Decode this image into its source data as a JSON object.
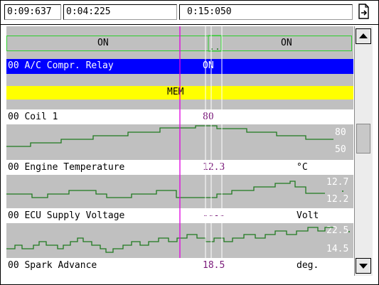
{
  "toolbar": {
    "time_start": "0:09:637",
    "time_mid": "0:04:225",
    "time_end": "0:15:050"
  },
  "channels": [
    {
      "name": "00 A/C Compr. Relay",
      "value": "ON",
      "unit": "",
      "state_left": "ON",
      "state_right": "ON"
    },
    {
      "name": "",
      "value": "MEM",
      "unit": ""
    },
    {
      "name": "00 Coil 1",
      "value": "80",
      "unit": "",
      "scale_max": "80",
      "scale_min": "50"
    },
    {
      "name": "00 Engine Temperature",
      "value": "12.3",
      "unit": "°C",
      "scale_max": "12.7",
      "scale_min": "12.2"
    },
    {
      "name": "00 ECU Supply Voltage",
      "value": "----",
      "unit": "Volt",
      "scale_max": "22.5",
      "scale_min": "14.5"
    },
    {
      "name": "00 Spark Advance",
      "value": "18.5",
      "unit": "deg.",
      "scale_max": "",
      "scale_min": ""
    }
  ],
  "colors": {
    "trace": "#1f7a1f",
    "cursor": "#e000e0",
    "highlight": "#0000ff",
    "mem_band": "#ffff00",
    "plot_bg": "#c0c0c0"
  },
  "icons": {
    "export": "document-arrow-icon",
    "scroll_up": "arrow-up-icon",
    "scroll_down": "arrow-down-icon"
  }
}
